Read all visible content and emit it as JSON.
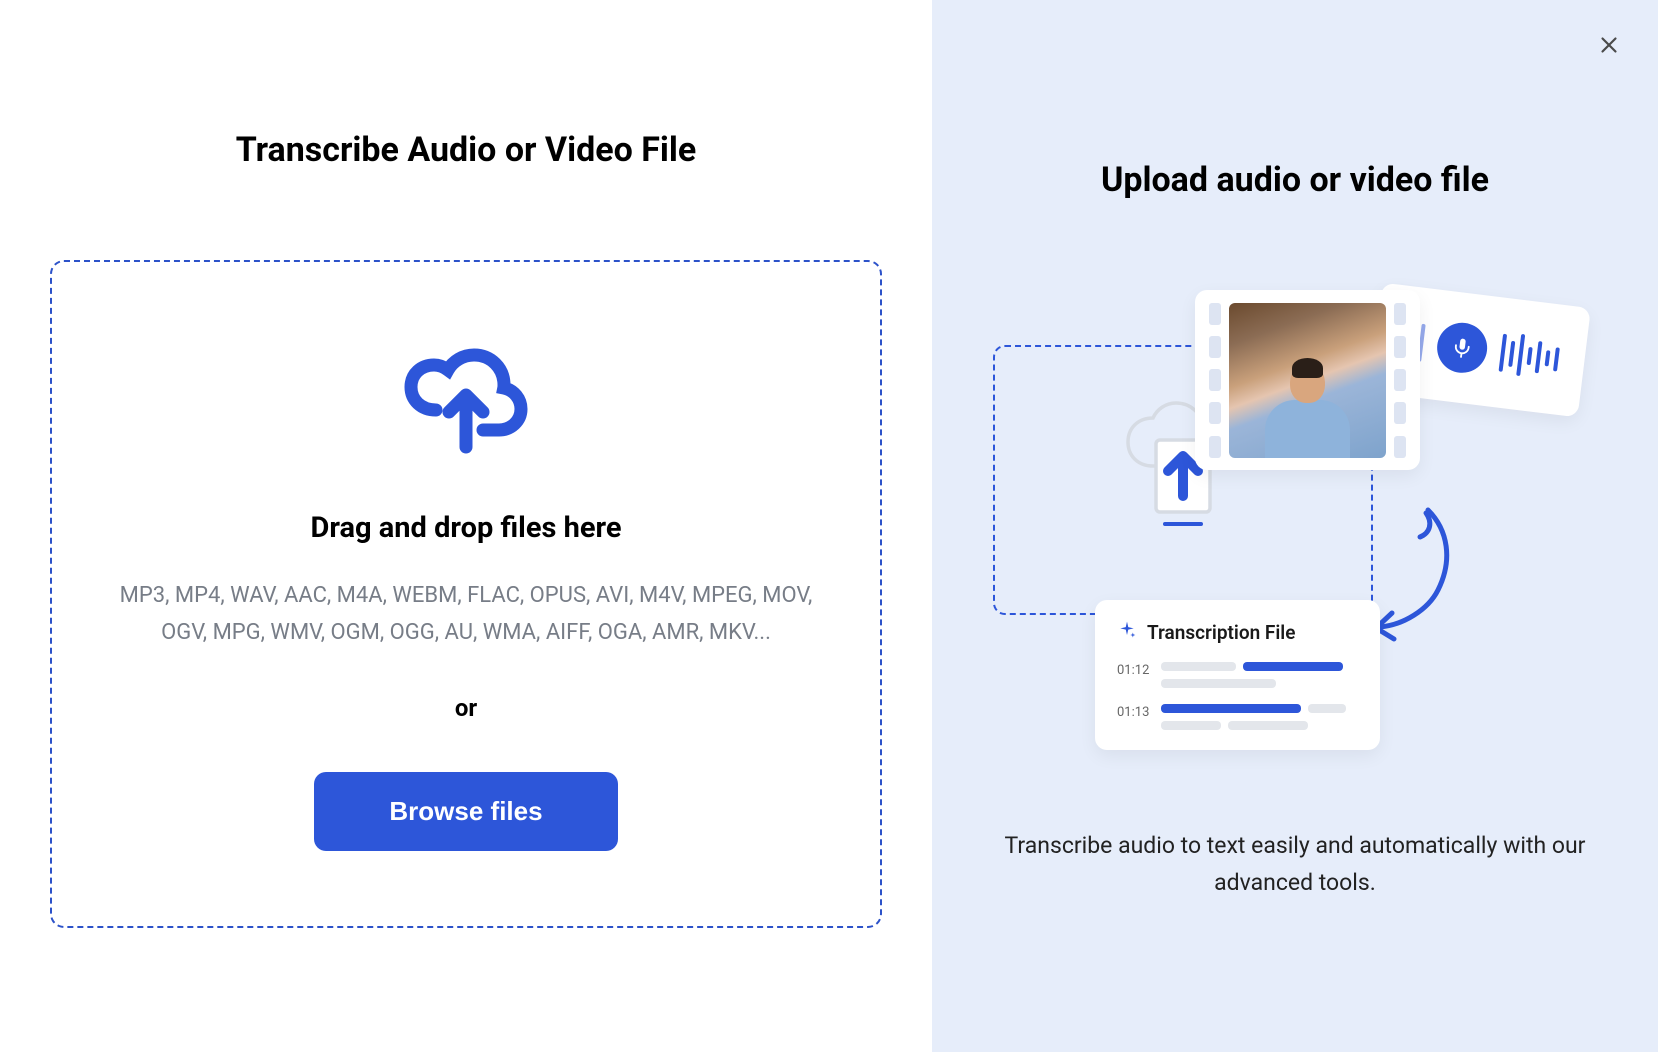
{
  "left": {
    "title": "Transcribe Audio or Video File",
    "drop_heading": "Drag and drop files here",
    "formats": "MP3, MP4, WAV, AAC, M4A, WEBM, FLAC, OPUS, AVI, M4V, MPEG, MOV, OGV, MPG, WMV, OGM, OGG, AU, WMA, AIFF, OGA, AMR, MKV...",
    "or": "or",
    "browse_button": "Browse files"
  },
  "right": {
    "title": "Upload audio or video file",
    "transcription_card": {
      "title": "Transcription File",
      "time1": "01:12",
      "time2": "01:13"
    },
    "description": "Transcribe audio to text easily and automatically with our advanced tools."
  }
}
